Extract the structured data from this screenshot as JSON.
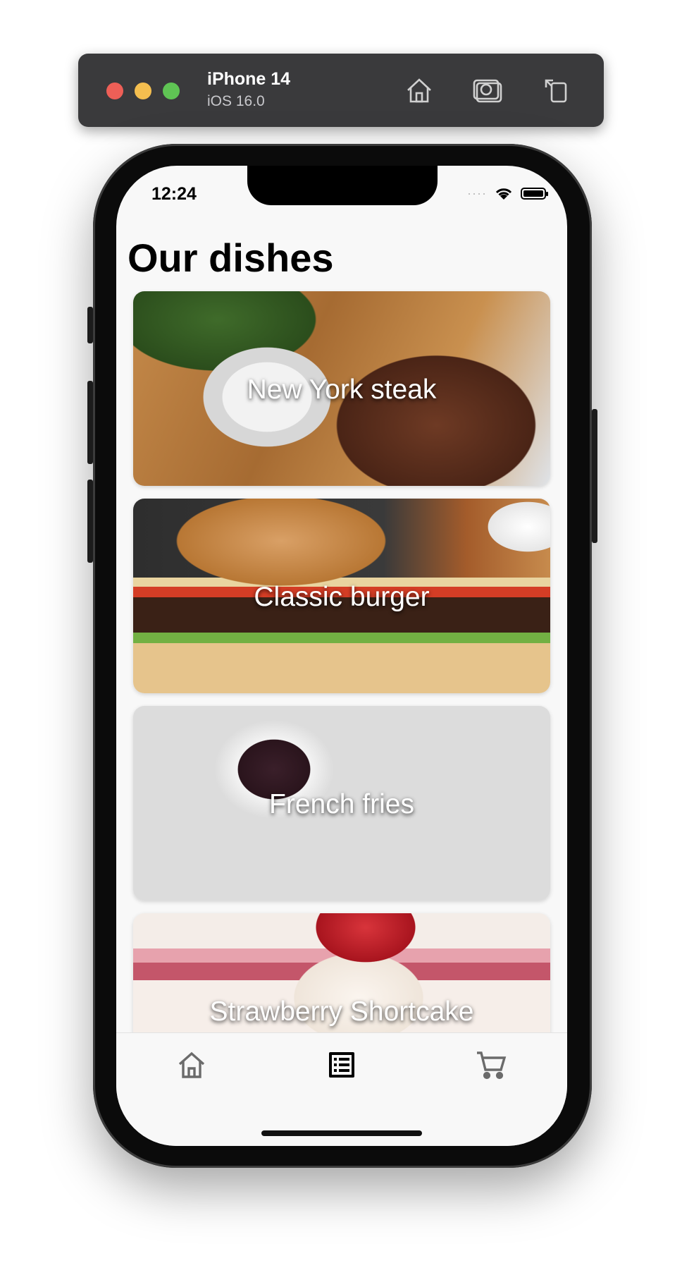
{
  "simulator": {
    "device_name": "iPhone 14",
    "os_version": "iOS 16.0",
    "icons": [
      "home-icon",
      "screenshot-icon",
      "rotate-icon"
    ]
  },
  "status_bar": {
    "time": "12:24"
  },
  "page": {
    "title": "Our dishes"
  },
  "dishes": [
    {
      "name": "New York steak",
      "image": "steak-image"
    },
    {
      "name": "Classic burger",
      "image": "burger-image"
    },
    {
      "name": "French fries",
      "image": "fries-image"
    },
    {
      "name": "Strawberry Shortcake",
      "image": "cake-image"
    }
  ],
  "tab_bar": {
    "tabs": [
      {
        "icon": "home-icon",
        "active": false
      },
      {
        "icon": "list-icon",
        "active": true
      },
      {
        "icon": "cart-icon",
        "active": false
      }
    ],
    "active_color": "#000000",
    "inactive_color": "#6b6b6b"
  }
}
